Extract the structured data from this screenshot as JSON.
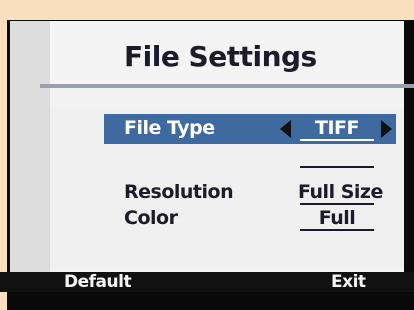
{
  "menu": {
    "title": "File Settings",
    "items": [
      {
        "label": "File Type",
        "value": "TIFF",
        "selected": true
      },
      {
        "label": "Resolution",
        "value": "Full Size",
        "selected": false
      },
      {
        "label": "Color",
        "value": "Full",
        "selected": false
      }
    ]
  },
  "softkeys": {
    "left": "Default",
    "right": "Exit"
  },
  "colors": {
    "background": "#f8dfbe",
    "highlight": "#3f6a9f",
    "bar": "#111111"
  }
}
